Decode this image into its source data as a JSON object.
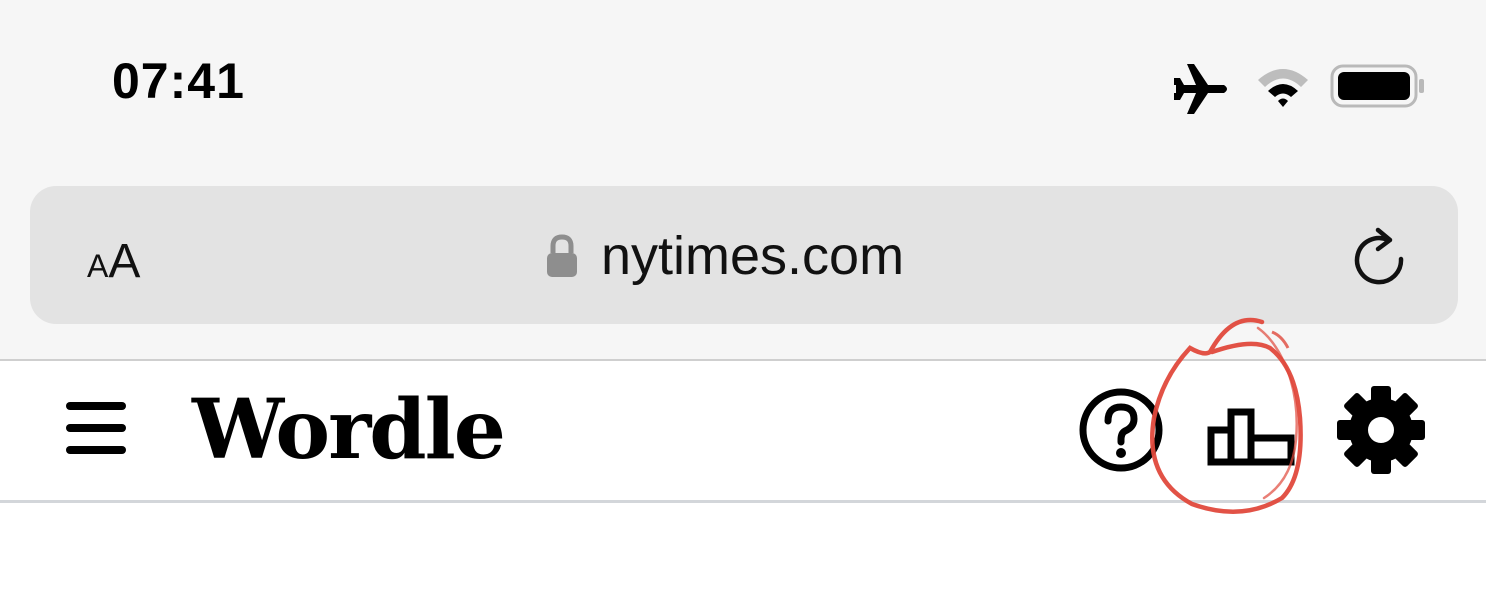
{
  "status_bar": {
    "time": "07:41",
    "icons": [
      "airplane-icon",
      "wifi-icon",
      "battery-icon"
    ]
  },
  "browser": {
    "text_size_label_small": "A",
    "text_size_label_large": "A",
    "url": "nytimes.com",
    "icons": [
      "lock-icon",
      "reload-icon"
    ]
  },
  "app_header": {
    "title": "Wordle",
    "icons": [
      "menu-icon",
      "help-icon",
      "statistics-icon",
      "settings-icon"
    ]
  },
  "annotation": {
    "shape": "hand-drawn circle",
    "target": "statistics-icon",
    "color": "#e0493c"
  },
  "colors": {
    "chrome_background": "#f6f6f6",
    "url_bar": "#e3e3e3",
    "header_border": "#d3d6da",
    "text": "#000000"
  }
}
